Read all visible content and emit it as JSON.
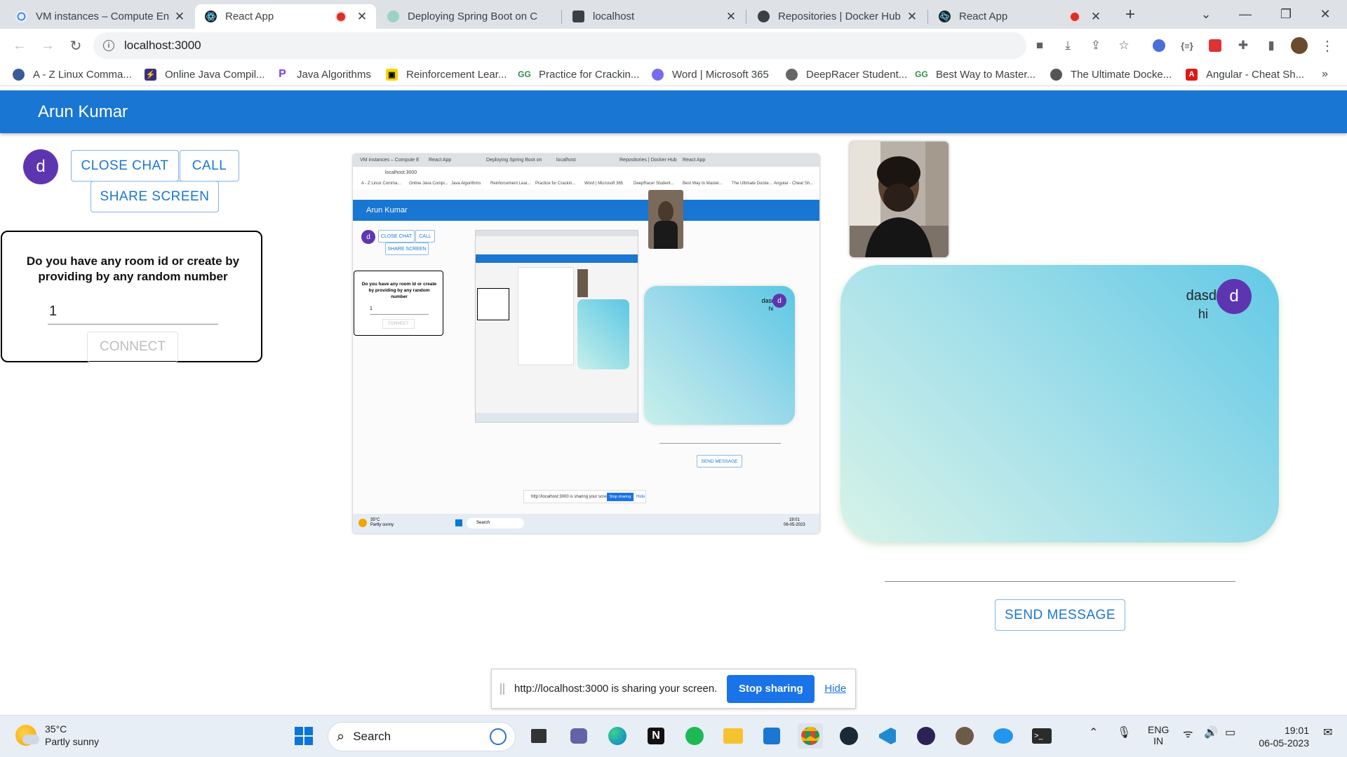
{
  "browser": {
    "tabs": [
      {
        "title": "VM instances – Compute En",
        "active": false,
        "recording": false
      },
      {
        "title": "React App",
        "active": true,
        "recording": true
      },
      {
        "title": "Deploying Spring Boot on C",
        "active": false,
        "recording": false
      },
      {
        "title": "localhost",
        "active": false,
        "recording": false
      },
      {
        "title": "Repositories | Docker Hub",
        "active": false,
        "recording": false
      },
      {
        "title": "React App",
        "active": false,
        "recording": true
      }
    ],
    "new_tab": "+",
    "url": "localhost:3000",
    "bookmarks": [
      "A - Z Linux Comma...",
      "Online Java Compil...",
      "Java Algorithms",
      "Reinforcement Lear...",
      "Practice for Crackin...",
      "Word | Microsoft 365",
      "DeepRacer Student...",
      "Best Way to Master...",
      "The Ultimate Docke...",
      "Angular - Cheat Sh..."
    ],
    "bookmarks_more": "»"
  },
  "app": {
    "title": "Arun Kumar",
    "avatar_letter": "d",
    "buttons": {
      "close_chat": "CLOSE CHAT",
      "call": "CALL",
      "share_screen": "SHARE SCREEN"
    },
    "room": {
      "question": "Do you have any room id or create by providing by any random number",
      "value": "1",
      "connect": "CONNECT"
    },
    "chat": {
      "sender": "dasd",
      "avatar_letter": "d",
      "message": "hi"
    },
    "send_message": "SEND MESSAGE"
  },
  "sharing_bar": {
    "text": "http://localhost:3000 is sharing your screen.",
    "stop": "Stop sharing",
    "hide": "Hide"
  },
  "taskbar": {
    "weather_temp": "35°C",
    "weather_desc": "Partly sunny",
    "search": "Search",
    "lang_top": "ENG",
    "lang_bottom": "IN",
    "time": "19:01",
    "date": "06-05-2023"
  }
}
